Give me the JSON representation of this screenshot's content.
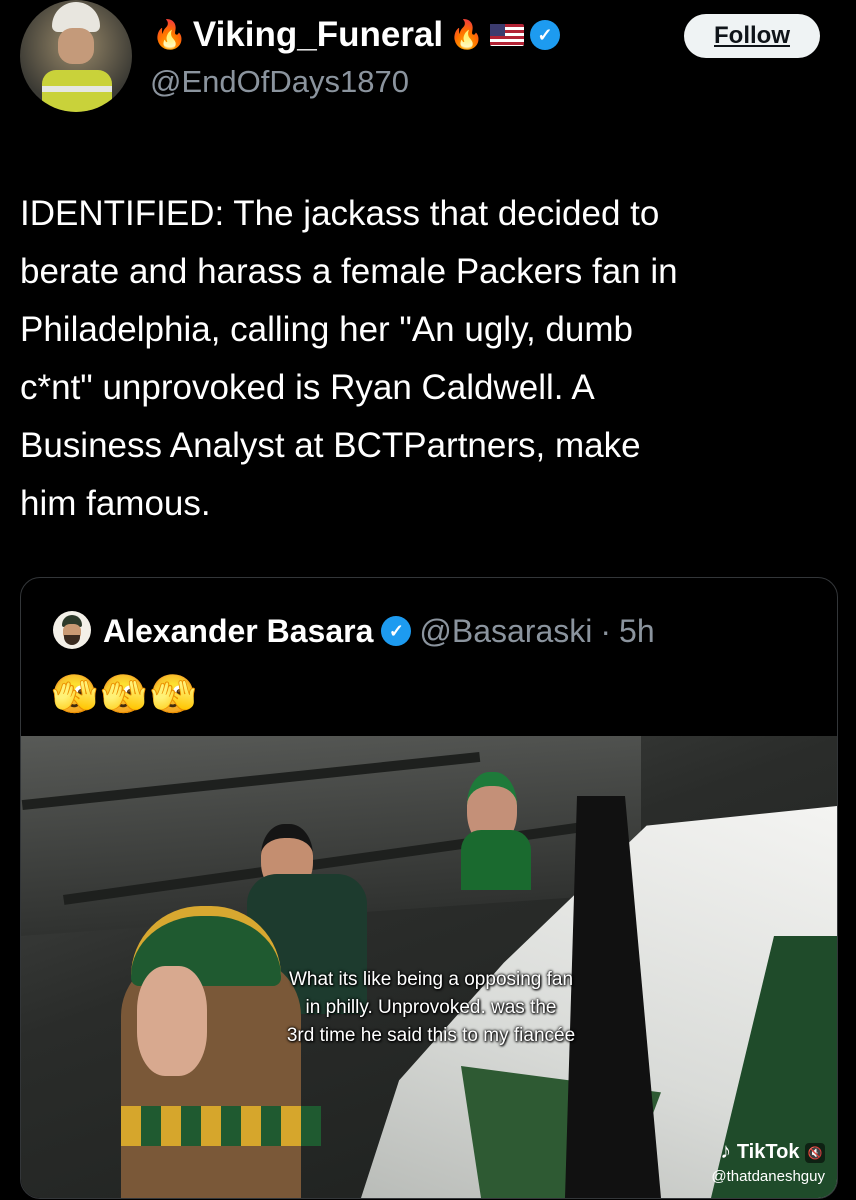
{
  "author": {
    "display_name": "Viking_Funeral",
    "name_prefix_emoji": "🔥",
    "name_suffix_emoji": "🔥",
    "flag_icon": "us-flag-icon",
    "verified_icon": "verified-badge-icon",
    "handle": "@EndOfDays1870"
  },
  "follow_button": {
    "label": "Follow"
  },
  "tweet": {
    "text": "IDENTIFIED:  The jackass that decided to\nberate and harass a female Packers fan in\nPhiladelphia, calling her \"An ugly, dumb\nc*nt\" unprovoked is Ryan Caldwell.  A\nBusiness Analyst at BCTPartners, make\nhim famous."
  },
  "quoted_tweet": {
    "display_name": "Alexander Basara",
    "verified_icon": "verified-badge-icon",
    "handle": "@Basaraski",
    "separator": "·",
    "time": "5h",
    "emoji_text": "🫣🫣🫣",
    "video": {
      "caption": "What its like being a opposing fan\nin philly. Unprovoked. was the\n3rd time he said this to my fiancée",
      "watermark_note": "♪",
      "watermark_brand": "TikTok",
      "watermark_handle": "@thatdaneshguy",
      "mute_icon_glyph": "🔇"
    }
  },
  "colors": {
    "background": "#000000",
    "text": "#ffffff",
    "secondary_text": "#8b949e",
    "verified": "#1d9bf0",
    "border": "#333639"
  }
}
